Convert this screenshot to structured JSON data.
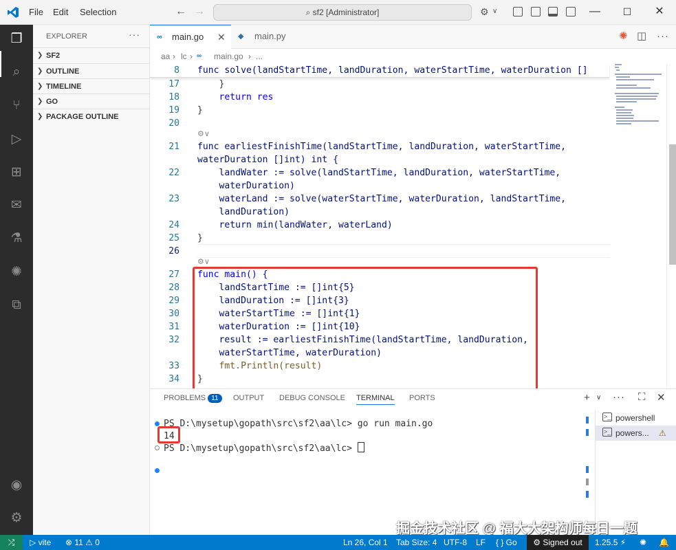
{
  "titlebar": {
    "menu": [
      "File",
      "Edit",
      "Selection"
    ],
    "search_text": "sf2 [Administrator]",
    "colors": {
      "accent": "#007acc",
      "logo": "#0078d4"
    }
  },
  "activity_bar": {
    "icons": [
      "explorer-icon",
      "search-icon",
      "source-control-icon",
      "run-debug-icon",
      "extensions-icon",
      "chat-icon",
      "testing-icon",
      "ai-assistant-icon",
      "remote-explorer-icon",
      "accounts-icon",
      "settings-icon"
    ]
  },
  "sidebar": {
    "title": "EXPLORER",
    "more": "···",
    "sections": [
      "SF2",
      "OUTLINE",
      "TIMELINE",
      "GO",
      "PACKAGE OUTLINE"
    ]
  },
  "tabs": [
    {
      "label": "main.go",
      "icon": "go-file-icon",
      "active": true
    },
    {
      "label": "main.py",
      "icon": "python-file-icon",
      "active": false
    }
  ],
  "breadcrumb": [
    "aa",
    "lc",
    "main.go",
    "..."
  ],
  "editor": {
    "sticky": {
      "num": "8",
      "text": "func solve(landStartTime, landDuration, waterStartTime, waterDuration []"
    },
    "codelens": [
      "⚙∨",
      "⚙∨"
    ],
    "line_numbers": [
      "17",
      "18",
      "19",
      "20",
      "21",
      "",
      "22",
      "",
      "23",
      "",
      "24",
      "25",
      "26",
      "27",
      "28",
      "29",
      "30",
      "31",
      "32",
      "",
      "33",
      "34"
    ],
    "code": [
      "    }",
      "    return res",
      "}",
      "",
      "func earliestFinishTime(landStartTime, landDuration, waterStartTime,",
      "waterDuration []int) int {",
      "    landWater := solve(landStartTime, landDuration, waterStartTime,",
      "    waterDuration)",
      "    waterLand := solve(waterStartTime, waterDuration, landStartTime,",
      "    landDuration)",
      "    return min(landWater, waterLand)",
      "}",
      "",
      "func main() {",
      "    landStartTime := []int{5}",
      "    landDuration := []int{3}",
      "    waterStartTime := []int{1}",
      "    waterDuration := []int{10}",
      "    result := earliestFinishTime(landStartTime, landDuration,",
      "    waterStartTime, waterDuration)",
      "    fmt.Println(result)",
      "}"
    ]
  },
  "panel": {
    "tabs": [
      "PROBLEMS",
      "OUTPUT",
      "DEBUG CONSOLE",
      "TERMINAL",
      "PORTS"
    ],
    "problems_count": "11",
    "active_tab": "TERMINAL",
    "terminal": {
      "lines": [
        "PS D:\\mysetup\\gopath\\src\\sf2\\aa\\lc> go run main.go",
        "14",
        "PS D:\\mysetup\\gopath\\src\\sf2\\aa\\lc> "
      ]
    },
    "terminal_list": [
      {
        "label": "powershell",
        "selected": false
      },
      {
        "label": "powers...",
        "selected": true,
        "warning": "⚠"
      }
    ]
  },
  "status": {
    "vite": "vite",
    "problems": "⊗ 11 ⚠ 0",
    "position": "Ln 26, Col 1",
    "tab_size": "Tab Size: 4",
    "encoding": "UTF-8",
    "eol": "LF",
    "language": "{ } Go",
    "account": "Signed out",
    "go_version": "1.25.5"
  },
  "watermark": "掘金技术社区 @ 福大大架构师每日一题"
}
